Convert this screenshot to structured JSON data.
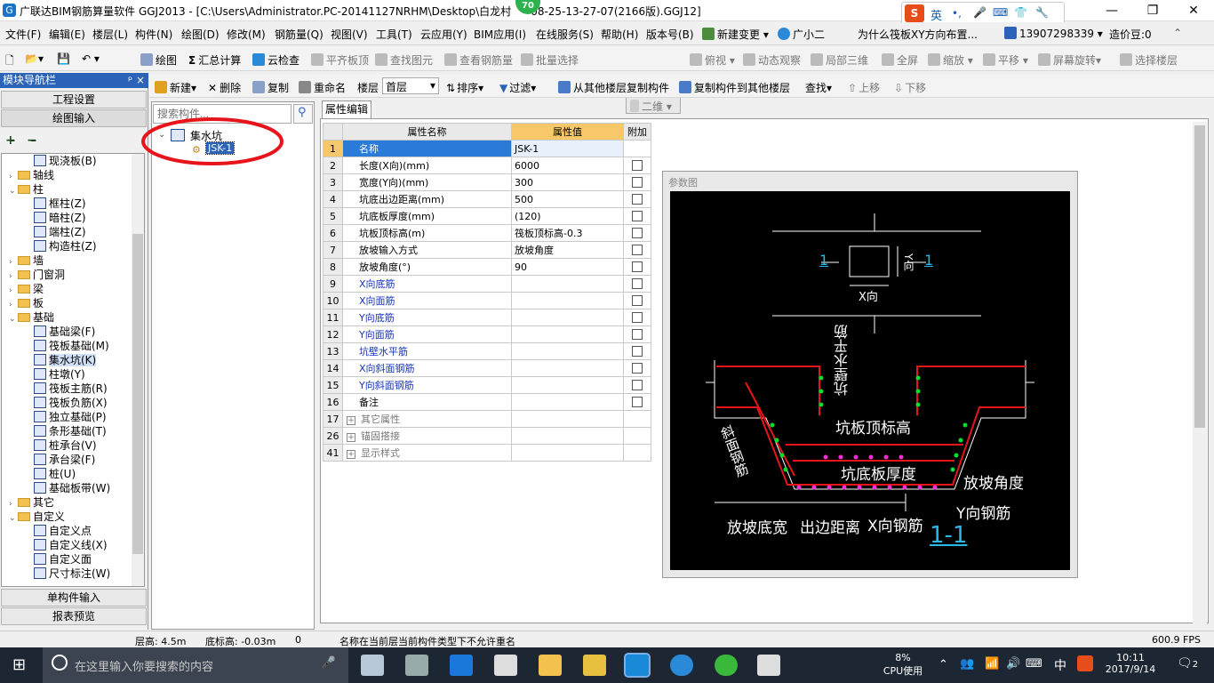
{
  "window": {
    "title": "广联达BIM钢筋算量软件 GGJ2013 - [C:\\Users\\Administrator.PC-20141127NRHM\\Desktop\\白龙村",
    "title_tail": "08-25-13-27-07(2166版).GGJ12]",
    "badge": "70",
    "minimize": "—",
    "restore": "❐",
    "close": "✕"
  },
  "ime": {
    "logo": "S",
    "lang": "英"
  },
  "menubar": {
    "items": [
      "文件(F)",
      "编辑(E)",
      "楼层(L)",
      "构件(N)",
      "绘图(D)",
      "修改(M)",
      "钢筋量(Q)",
      "视图(V)",
      "工具(T)",
      "云应用(Y)",
      "BIM应用(I)",
      "在线服务(S)",
      "帮助(H)",
      "版本号(B)"
    ],
    "new_change": "新建变更",
    "assistant": "广小二",
    "question": "为什么筏板XY方向布置...",
    "phone": "13907298339",
    "beans": "造价豆:0"
  },
  "toolbar1": {
    "items": [
      "绘图",
      "汇总计算",
      "云检查",
      "平齐板顶",
      "查找图元",
      "查看钢筋量",
      "批量选择"
    ],
    "view_select": "二维",
    "items2": [
      "俯视",
      "动态观察",
      "局部三维",
      "全屏",
      "缩放",
      "平移",
      "屏幕旋转",
      "选择楼层"
    ]
  },
  "nav": {
    "header": "模块导航栏",
    "pin": "ᵖ ×",
    "project_settings": "工程设置",
    "draw_input": "绘图输入",
    "single_input": "单构件输入",
    "report_preview": "报表预览",
    "tree": [
      {
        "indent": 2,
        "type": "leaf",
        "label": "现浇板(B)"
      },
      {
        "indent": 0,
        "type": "folder",
        "exp": "›",
        "label": "轴线"
      },
      {
        "indent": 0,
        "type": "folder",
        "exp": "⌄",
        "label": "柱"
      },
      {
        "indent": 2,
        "type": "leaf",
        "label": "框柱(Z)"
      },
      {
        "indent": 2,
        "type": "leaf",
        "label": "暗柱(Z)"
      },
      {
        "indent": 2,
        "type": "leaf",
        "label": "端柱(Z)"
      },
      {
        "indent": 2,
        "type": "leaf",
        "label": "构造柱(Z)"
      },
      {
        "indent": 0,
        "type": "folder",
        "exp": "›",
        "label": "墙"
      },
      {
        "indent": 0,
        "type": "folder",
        "exp": "›",
        "label": "门窗洞"
      },
      {
        "indent": 0,
        "type": "folder",
        "exp": "›",
        "label": "梁"
      },
      {
        "indent": 0,
        "type": "folder",
        "exp": "›",
        "label": "板"
      },
      {
        "indent": 0,
        "type": "folder",
        "exp": "⌄",
        "label": "基础"
      },
      {
        "indent": 2,
        "type": "leaf",
        "label": "基础梁(F)"
      },
      {
        "indent": 2,
        "type": "leaf",
        "label": "筏板基础(M)"
      },
      {
        "indent": 2,
        "type": "leaf",
        "label": "集水坑(K)",
        "selected": true
      },
      {
        "indent": 2,
        "type": "leaf",
        "label": "柱墩(Y)"
      },
      {
        "indent": 2,
        "type": "leaf",
        "label": "筏板主筋(R)"
      },
      {
        "indent": 2,
        "type": "leaf",
        "label": "筏板负筋(X)"
      },
      {
        "indent": 2,
        "type": "leaf",
        "label": "独立基础(P)"
      },
      {
        "indent": 2,
        "type": "leaf",
        "label": "条形基础(T)"
      },
      {
        "indent": 2,
        "type": "leaf",
        "label": "桩承台(V)"
      },
      {
        "indent": 2,
        "type": "leaf",
        "label": "承台梁(F)"
      },
      {
        "indent": 2,
        "type": "leaf",
        "label": "桩(U)"
      },
      {
        "indent": 2,
        "type": "leaf",
        "label": "基础板带(W)"
      },
      {
        "indent": 0,
        "type": "folder",
        "exp": "›",
        "label": "其它"
      },
      {
        "indent": 0,
        "type": "folder",
        "exp": "⌄",
        "label": "自定义"
      },
      {
        "indent": 2,
        "type": "leaf",
        "label": "自定义点"
      },
      {
        "indent": 2,
        "type": "leaf",
        "label": "自定义线(X)"
      },
      {
        "indent": 2,
        "type": "leaf",
        "label": "自定义面"
      },
      {
        "indent": 2,
        "type": "leaf",
        "label": "尺寸标注(W)"
      }
    ]
  },
  "toolbar2": {
    "items": [
      "新建",
      "删除",
      "复制",
      "重命名"
    ],
    "floor_label": "楼层",
    "floor_value": "首层",
    "items2": [
      "排序",
      "过滤",
      "从其他楼层复制构件",
      "复制构件到其他楼层",
      "查找",
      "上移",
      "下移"
    ]
  },
  "component": {
    "search_placeholder": "搜索构件...",
    "group": "集水坑",
    "item": "JSK-1"
  },
  "props": {
    "tab": "属性编辑",
    "headers": [
      "属性名称",
      "属性值",
      "附加"
    ],
    "rows": [
      {
        "n": "1",
        "name": "名称",
        "value": "JSK-1",
        "style": "selected",
        "check": false
      },
      {
        "n": "2",
        "name": "长度(X向)(mm)",
        "value": "6000",
        "style": "",
        "check": true
      },
      {
        "n": "3",
        "name": "宽度(Y向)(mm)",
        "value": "300",
        "style": "",
        "check": true
      },
      {
        "n": "4",
        "name": "坑底出边距离(mm)",
        "value": "500",
        "style": "",
        "check": true
      },
      {
        "n": "5",
        "name": "坑底板厚度(mm)",
        "value": "(120)",
        "style": "",
        "check": true
      },
      {
        "n": "6",
        "name": "坑板顶标高(m)",
        "value": "筏板顶标高-0.3",
        "style": "",
        "check": true
      },
      {
        "n": "7",
        "name": "放坡输入方式",
        "value": "放坡角度",
        "style": "",
        "check": true
      },
      {
        "n": "8",
        "name": "放坡角度(°)",
        "value": "90",
        "style": "",
        "check": true
      },
      {
        "n": "9",
        "name": "X向底筋",
        "value": "",
        "style": "blue",
        "check": true
      },
      {
        "n": "10",
        "name": "X向面筋",
        "value": "",
        "style": "blue",
        "check": true
      },
      {
        "n": "11",
        "name": "Y向底筋",
        "value": "",
        "style": "blue",
        "check": true
      },
      {
        "n": "12",
        "name": "Y向面筋",
        "value": "",
        "style": "blue",
        "check": true
      },
      {
        "n": "13",
        "name": "坑壁水平筋",
        "value": "",
        "style": "blue",
        "check": true
      },
      {
        "n": "14",
        "name": "X向斜面钢筋",
        "value": "",
        "style": "blue",
        "check": true
      },
      {
        "n": "15",
        "name": "Y向斜面钢筋",
        "value": "",
        "style": "blue",
        "check": true
      },
      {
        "n": "16",
        "name": "备注",
        "value": "",
        "style": "",
        "check": true
      },
      {
        "n": "17",
        "name": "其它属性",
        "value": "",
        "style": "group",
        "check": false
      },
      {
        "n": "26",
        "name": "锚固搭接",
        "value": "",
        "style": "group",
        "check": false
      },
      {
        "n": "41",
        "name": "显示样式",
        "value": "",
        "style": "group",
        "check": false
      }
    ]
  },
  "param": {
    "title": "参数图",
    "section_mark": "1",
    "x_dir": "X向",
    "y_dir": "Y向",
    "wall_rebar": "坑壁水平筋",
    "slope_rebar": "斜面钢筋",
    "top_elev": "坑板顶标高",
    "thickness": "坑底板厚度",
    "slope_angle": "放坡角度",
    "slope_width": "放坡底宽",
    "edge_dist": "出边距离",
    "x_rebar": "X向钢筋",
    "y_rebar": "Y向钢筋",
    "section": "1-1"
  },
  "statusbar": {
    "floor_height": "层高: 4.5m",
    "bottom_elev": "底标高: -0.03m",
    "zero": "0",
    "message": "名称在当前层当前构件类型下不允许重名",
    "fps": "600.9 FPS"
  },
  "taskbar": {
    "search_placeholder": "在这里输入你要搜索的内容",
    "cpu_pct": "8%",
    "cpu_label": "CPU使用",
    "lang": "中",
    "time": "10:11",
    "date": "2017/9/14",
    "notif": "2"
  },
  "colors": {
    "accent": "#2a63b8",
    "highlight": "#cfe0f7",
    "red_annot": "#e8141b"
  }
}
